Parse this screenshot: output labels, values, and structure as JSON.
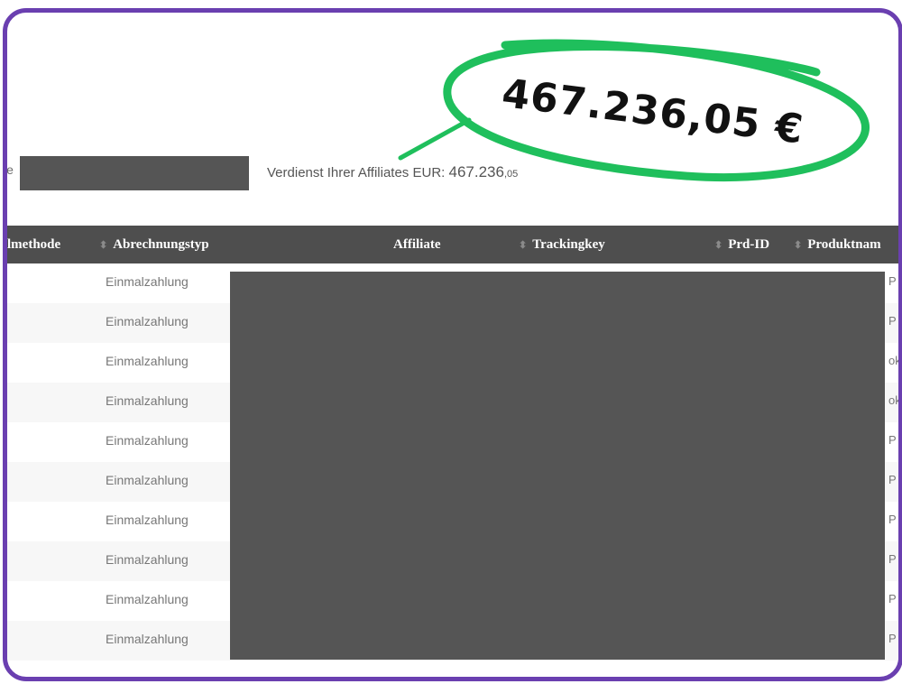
{
  "summary": {
    "partial_label": "ie",
    "earnings_label": "Verdienst Ihrer Affiliates EUR:",
    "earnings_main": "467.236",
    "earnings_cents": ",05"
  },
  "callout": {
    "amount": "467.236,05 €",
    "accent_color": "#1fbf5c",
    "frame_color": "#6a3fb0"
  },
  "table": {
    "headers": [
      "lmethode",
      "Abrechnungstyp",
      "Affiliate",
      "Trackingkey",
      "Prd-ID",
      "Produktnam"
    ],
    "rows": [
      {
        "abrechnungstyp": "Einmalzahlung",
        "edge": "P"
      },
      {
        "abrechnungstyp": "Einmalzahlung",
        "edge": "P"
      },
      {
        "abrechnungstyp": "Einmalzahlung",
        "edge": "ok"
      },
      {
        "abrechnungstyp": "Einmalzahlung",
        "edge": "ok"
      },
      {
        "abrechnungstyp": "Einmalzahlung",
        "edge": "P"
      },
      {
        "abrechnungstyp": "Einmalzahlung",
        "edge": "P"
      },
      {
        "abrechnungstyp": "Einmalzahlung",
        "edge": "P"
      },
      {
        "abrechnungstyp": "Einmalzahlung",
        "edge": "P"
      },
      {
        "abrechnungstyp": "Einmalzahlung",
        "edge": "P"
      },
      {
        "abrechnungstyp": "Einmalzahlung",
        "edge": "P"
      }
    ]
  }
}
